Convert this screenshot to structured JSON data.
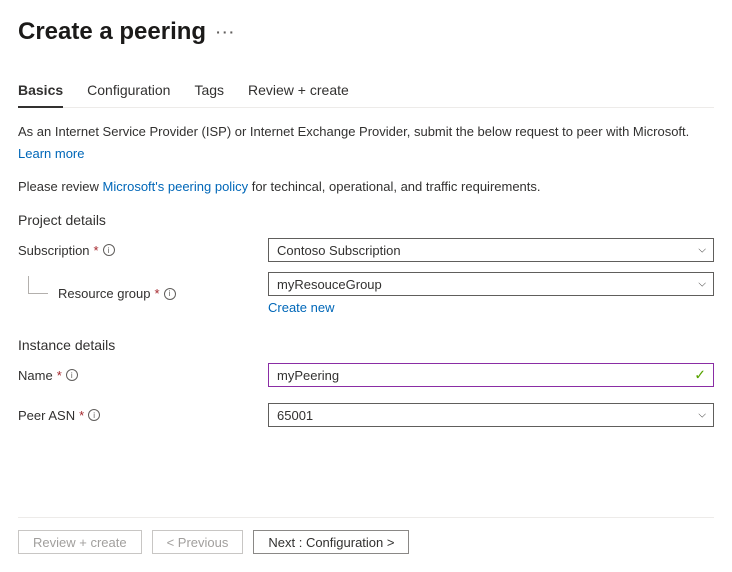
{
  "header": {
    "title": "Create a peering"
  },
  "tabs": [
    {
      "label": "Basics",
      "active": true
    },
    {
      "label": "Configuration",
      "active": false
    },
    {
      "label": "Tags",
      "active": false
    },
    {
      "label": "Review + create",
      "active": false
    }
  ],
  "description": {
    "line1": "As an Internet Service Provider (ISP) or Internet Exchange Provider, submit the below request to peer with Microsoft.",
    "learn_more": "Learn more",
    "line2_pre": "Please review ",
    "line2_link": "Microsoft's peering policy",
    "line2_post": " for techincal, operational, and traffic requirements."
  },
  "project_details": {
    "section_title": "Project details",
    "subscription": {
      "label": "Subscription",
      "value": "Contoso Subscription"
    },
    "resource_group": {
      "label": "Resource group",
      "value": "myResouceGroup",
      "create_new": "Create new"
    }
  },
  "instance_details": {
    "section_title": "Instance details",
    "name": {
      "label": "Name",
      "value": "myPeering"
    },
    "peer_asn": {
      "label": "Peer ASN",
      "value": "65001"
    }
  },
  "footer": {
    "review_create": "Review + create",
    "previous": "< Previous",
    "next": "Next : Configuration >"
  }
}
